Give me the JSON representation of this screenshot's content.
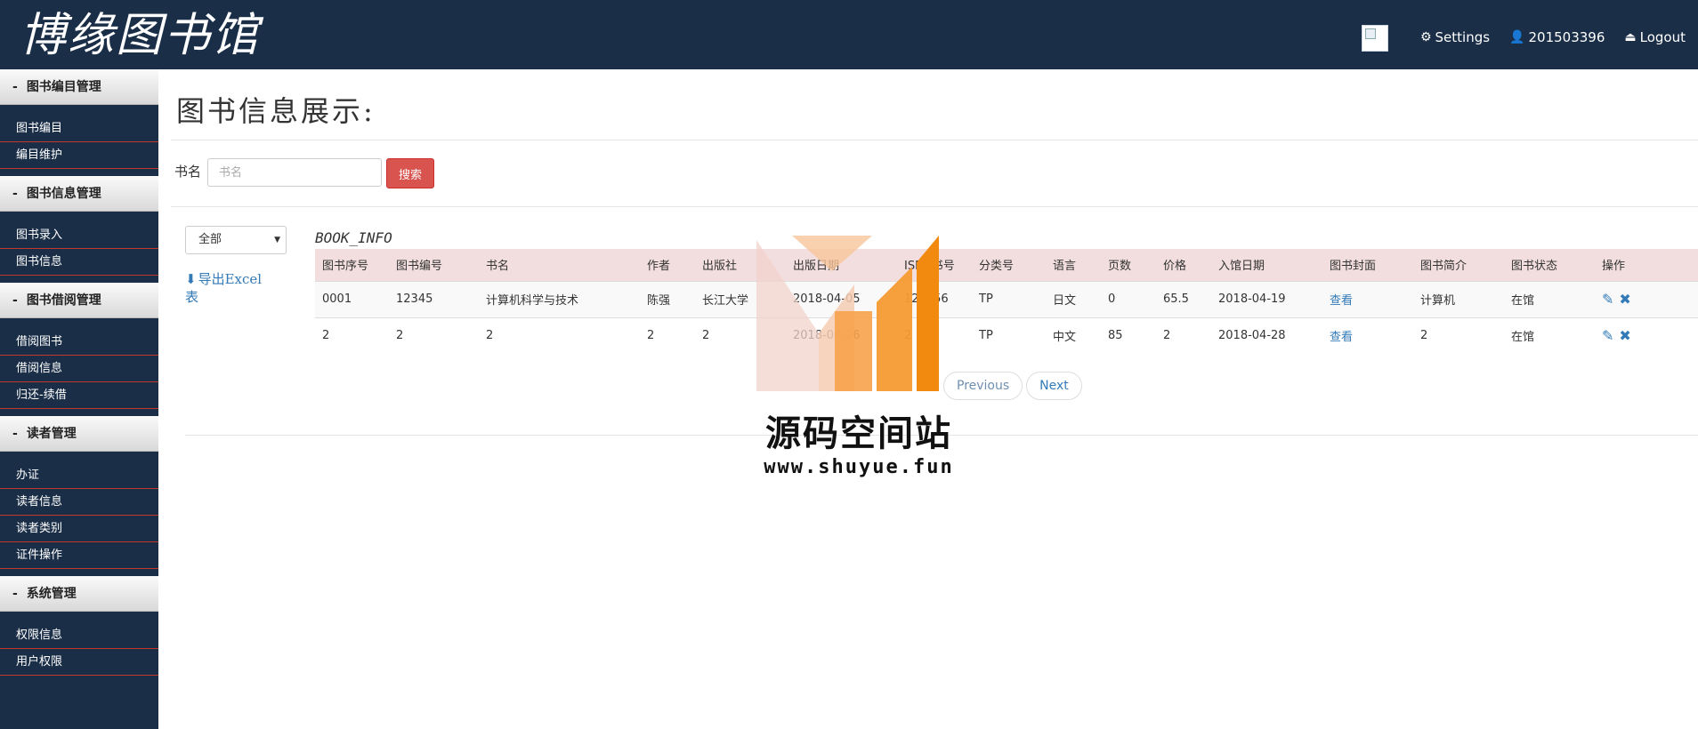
{
  "brand": {
    "logo_text": "博缘图书馆"
  },
  "topnav": {
    "settings_label": "Settings",
    "user_label": "201503396",
    "logout_label": "Logout"
  },
  "sidebar": {
    "groups": [
      {
        "title": "图书编目管理",
        "items": [
          "图书编目",
          "编目维护"
        ]
      },
      {
        "title": "图书信息管理",
        "items": [
          "图书录入",
          "图书信息"
        ]
      },
      {
        "title": "图书借阅管理",
        "items": [
          "借阅图书",
          "借阅信息",
          "归还-续借"
        ]
      },
      {
        "title": "读者管理",
        "items": [
          "办证",
          "读者信息",
          "读者类别",
          "证件操作"
        ]
      },
      {
        "title": "系统管理",
        "items": [
          "权限信息",
          "用户权限"
        ]
      }
    ]
  },
  "main": {
    "title": "图书信息展示:",
    "search": {
      "label": "书名",
      "placeholder": "书名",
      "button": "搜索"
    },
    "filter": {
      "selected": "全部"
    },
    "export_label": "导出Excel表",
    "table_caption": "BOOK_INFO",
    "columns": [
      "图书序号",
      "图书编号",
      "书名",
      "作者",
      "出版社",
      "出版日期",
      "ISBN书号",
      "分类号",
      "语言",
      "页数",
      "价格",
      "入馆日期",
      "图书封面",
      "图书简介",
      "图书状态",
      "操作"
    ],
    "rows": [
      [
        "0001",
        "12345",
        "计算机科学与技术",
        "陈强",
        "长江大学",
        "2018-04-05",
        "123456",
        "TP",
        "日文",
        "0",
        "65.5",
        "2018-04-19",
        "查看",
        "计算机",
        "在馆"
      ],
      [
        "2",
        "2",
        "2",
        "2",
        "2",
        "2018-04-26",
        "2",
        "TP",
        "中文",
        "85",
        "2",
        "2018-04-28",
        "查看",
        "2",
        "在馆"
      ]
    ],
    "pager": {
      "prev": "Previous",
      "next": "Next"
    }
  },
  "watermark": {
    "title": "源码空间站",
    "url": "www.shuyue.fun"
  },
  "colors": {
    "navbar": "#1a2e47",
    "search_button": "#d9534f",
    "table_header": "#f2dede",
    "link": "#337ab7",
    "sidebar_divider": "#c0392b"
  }
}
